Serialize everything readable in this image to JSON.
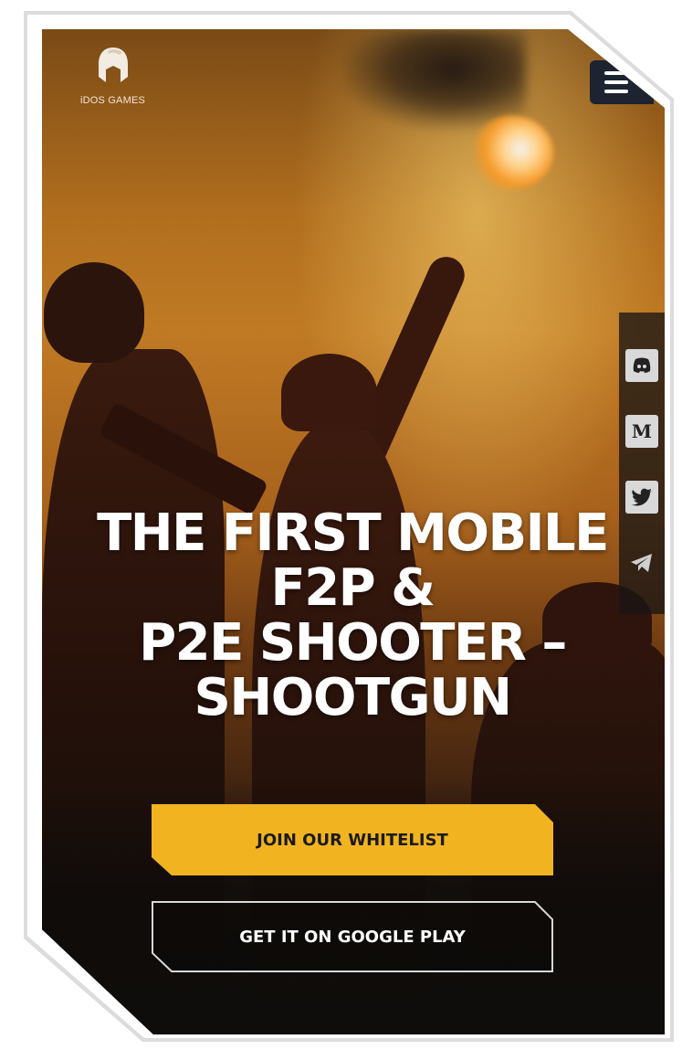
{
  "brand": {
    "logo_text": "iDOS GAMES",
    "logo_icon": "spartan-helmet-icon"
  },
  "header": {
    "menu_icon": "hamburger-menu-icon"
  },
  "social": {
    "items": [
      {
        "name": "discord-icon",
        "glyph": "☺"
      },
      {
        "name": "medium-icon",
        "glyph": "M"
      },
      {
        "name": "twitter-icon",
        "glyph": "❦"
      },
      {
        "name": "telegram-icon",
        "glyph": "➤"
      }
    ]
  },
  "hero": {
    "headline_line1": "THE FIRST MOBILE",
    "headline_line2": "F2P &",
    "headline_line3": "P2E SHOOTER –",
    "headline_line4": "SHOOTGUN"
  },
  "actions": {
    "whitelist_label": "JOIN OUR WHITELIST",
    "google_play_label": "GET IT ON GOOGLE PLAY"
  },
  "colors": {
    "accent": "#f2b321",
    "menu_bg": "#1d2330",
    "text_light": "#ffffff"
  }
}
